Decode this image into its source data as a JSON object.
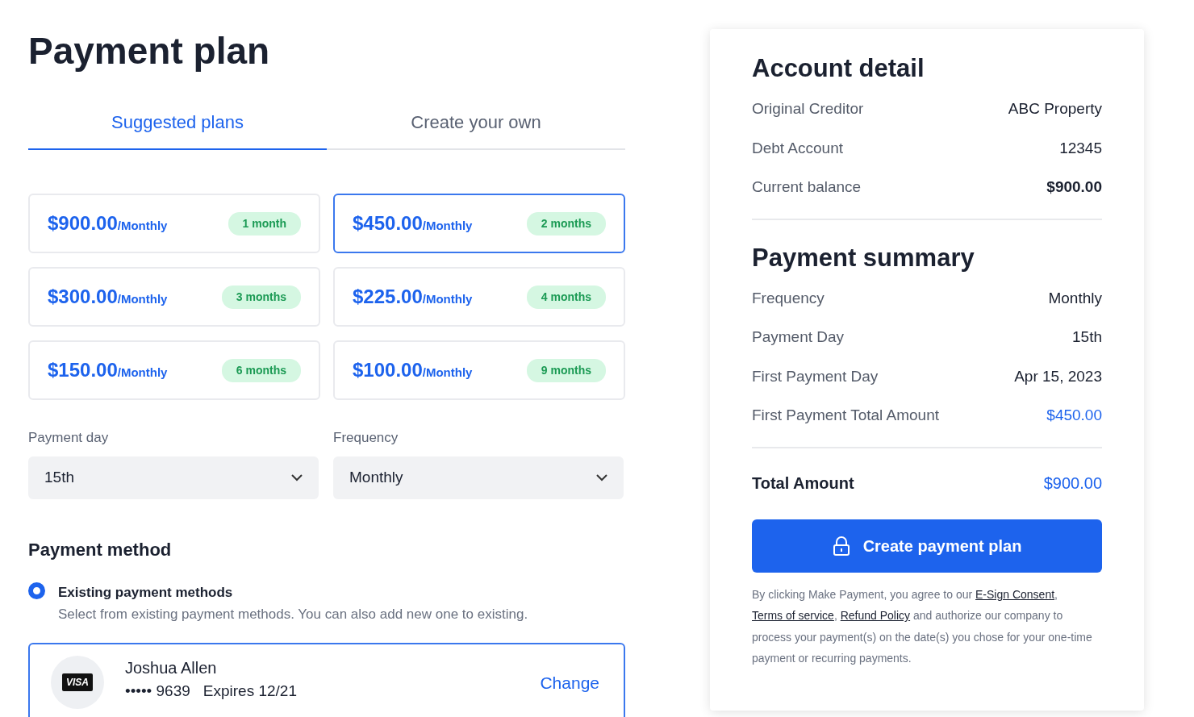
{
  "title": "Payment plan",
  "tabs": [
    {
      "label": "Suggested plans",
      "selected": true
    },
    {
      "label": "Create your own",
      "selected": false
    }
  ],
  "plans": [
    {
      "amount": "$900.00",
      "period": "/Monthly",
      "duration": "1 month",
      "selected": false
    },
    {
      "amount": "$450.00",
      "period": "/Monthly",
      "duration": "2 months",
      "selected": true
    },
    {
      "amount": "$300.00",
      "period": "/Monthly",
      "duration": "3 months",
      "selected": false
    },
    {
      "amount": "$225.00",
      "period": "/Monthly",
      "duration": "4 months",
      "selected": false
    },
    {
      "amount": "$150.00",
      "period": "/Monthly",
      "duration": "6 months",
      "selected": false
    },
    {
      "amount": "$100.00",
      "period": "/Monthly",
      "duration": "9 months",
      "selected": false
    }
  ],
  "selects": [
    {
      "label": "Payment day",
      "value": "15th"
    },
    {
      "label": "Frequency",
      "value": "Monthly"
    }
  ],
  "payment_method": {
    "heading": "Payment method",
    "option": {
      "label": "Existing payment methods",
      "description": "Select from existing payment methods. You can also add new one to existing.",
      "selected": true
    },
    "card": {
      "brand": "VISA",
      "name": "Joshua Allen",
      "masked": "••••• 9639",
      "expires": "Expires 12/21",
      "action": "Change"
    }
  },
  "account_detail": {
    "heading": "Account detail",
    "rows": [
      {
        "label": "Original Creditor",
        "value": "ABC Property",
        "kind": "plain"
      },
      {
        "label": "Debt Account",
        "value": "12345",
        "kind": "plain"
      },
      {
        "label": "Current balance",
        "value": "$900.00",
        "kind": "strong"
      }
    ]
  },
  "payment_summary": {
    "heading": "Payment summary",
    "rows": [
      {
        "label": "Frequency",
        "value": "Monthly",
        "kind": "plain"
      },
      {
        "label": "Payment Day",
        "value": "15th",
        "kind": "plain"
      },
      {
        "label": "First Payment Day",
        "value": "Apr 15, 2023",
        "kind": "plain"
      },
      {
        "label": "First Payment Total Amount",
        "value": "$450.00",
        "kind": "accent"
      }
    ],
    "total": {
      "label": "Total Amount",
      "value": "$900.00"
    }
  },
  "submit": {
    "label": "Create payment plan"
  },
  "legal": [
    {
      "kind": "text",
      "text": "By clicking Make Payment, you agree to our "
    },
    {
      "kind": "link",
      "text": "E-Sign Consent"
    },
    {
      "kind": "text",
      "text": ", "
    },
    {
      "kind": "link",
      "text": "Terms of service"
    },
    {
      "kind": "text",
      "text": ", "
    },
    {
      "kind": "link",
      "text": "Refund Policy"
    },
    {
      "kind": "text",
      "text": " and authorize our company to process your payment(s) on the date(s) you chose for your one-time payment or recurring payments."
    }
  ]
}
